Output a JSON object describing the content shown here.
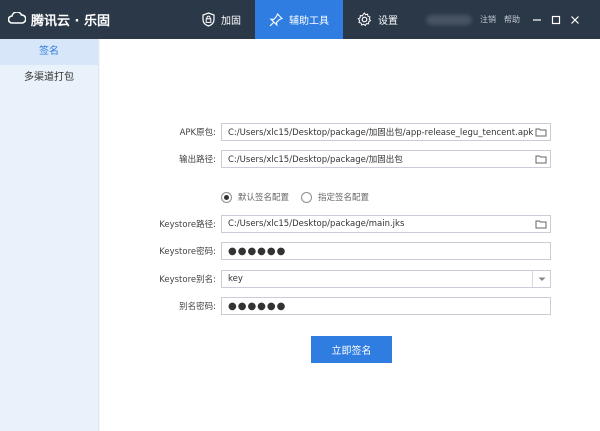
{
  "app": {
    "brand": "腾讯云 · 乐固"
  },
  "nav": [
    {
      "label": "加固",
      "icon": "shield-lock-icon"
    },
    {
      "label": "辅助工具",
      "icon": "pin-icon",
      "active": true
    },
    {
      "label": "设置",
      "icon": "gear-icon"
    }
  ],
  "titlebar": {
    "logout": "注销",
    "help": "帮助"
  },
  "sidebar": {
    "items": [
      {
        "label": "签名",
        "active": true
      },
      {
        "label": "多渠道打包"
      }
    ]
  },
  "form": {
    "apk_label": "APK原包:",
    "apk_value": "C:/Users/xlc15/Desktop/package/加固出包/app-release_legu_tencent.apk",
    "output_label": "输出路径:",
    "output_value": "C:/Users/xlc15/Desktop/package/加固出包",
    "radio_default": "默认签名配置",
    "radio_custom": "指定签名配置",
    "selected_radio": "default",
    "keystore_path_label": "Keystore路径:",
    "keystore_path_value": "C:/Users/xlc15/Desktop/package/main.jks",
    "keystore_pwd_label": "Keystore密码:",
    "keystore_pwd_value": "●●●●●●",
    "keystore_alias_label": "Keystore别名:",
    "keystore_alias_value": "key",
    "alias_pwd_label": "别名密码:",
    "alias_pwd_value": "●●●●●●",
    "submit": "立即签名"
  },
  "colors": {
    "titlebar": "#2b3848",
    "accent": "#2f7de1",
    "sidebar": "#e9f2fa"
  }
}
